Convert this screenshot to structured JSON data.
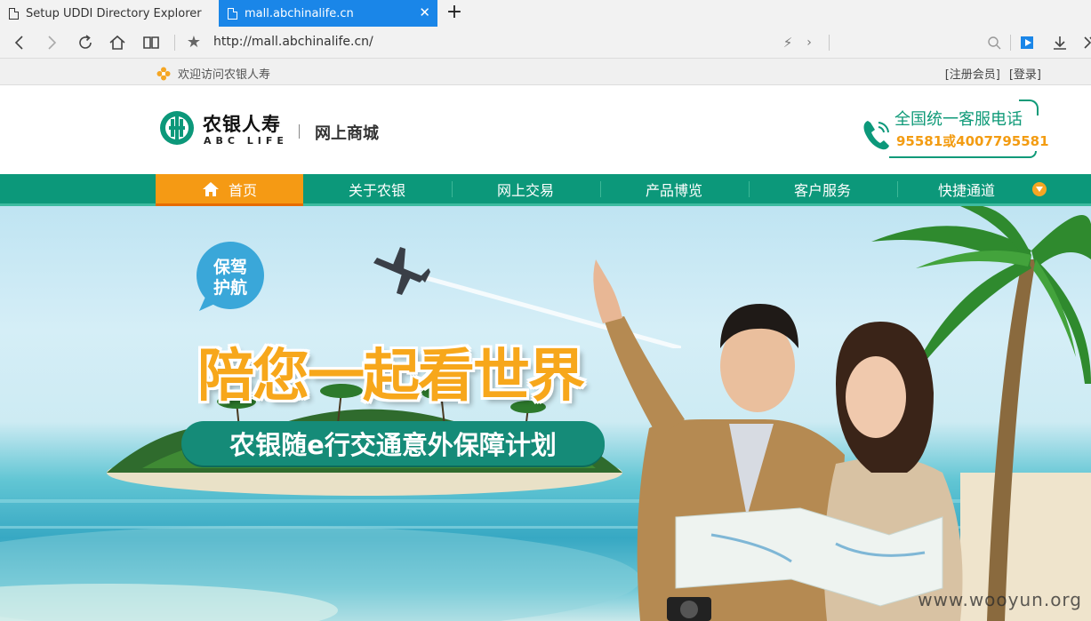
{
  "browser": {
    "tabs": [
      {
        "label": "Setup UDDI Directory Explorer",
        "active": false
      },
      {
        "label": "mall.abchinalife.cn",
        "active": true
      }
    ],
    "new_tab_label": "+",
    "close_label": "✕",
    "url": "http://mall.abchinalife.cn/",
    "accent_color": "#1a86e8"
  },
  "topbar": {
    "welcome": "欢迎访问农银人寿",
    "register": "[注册会员]",
    "login": "[登录]"
  },
  "header": {
    "logo_cn": "农银人寿",
    "logo_en": "ABC LIFE",
    "shop_title": "网上商城",
    "hotline_label": "全国统一客服电话",
    "hotline_numbers": "95581或4007795581"
  },
  "nav": {
    "items": [
      {
        "label": "首页",
        "active": true,
        "icon": "home-icon"
      },
      {
        "label": "关于农银"
      },
      {
        "label": "网上交易"
      },
      {
        "label": "产品博览"
      },
      {
        "label": "客户服务"
      },
      {
        "label": "快捷通道",
        "icon": "dropdown-icon"
      }
    ],
    "color": "#0c987a",
    "active_color": "#f59a14"
  },
  "banner": {
    "bubble_text": "保驾护航",
    "slogan": "陪您一起看世界",
    "plan_name": "农银随e行交通意外保障计划",
    "watermark": "www.wooyun.org"
  }
}
